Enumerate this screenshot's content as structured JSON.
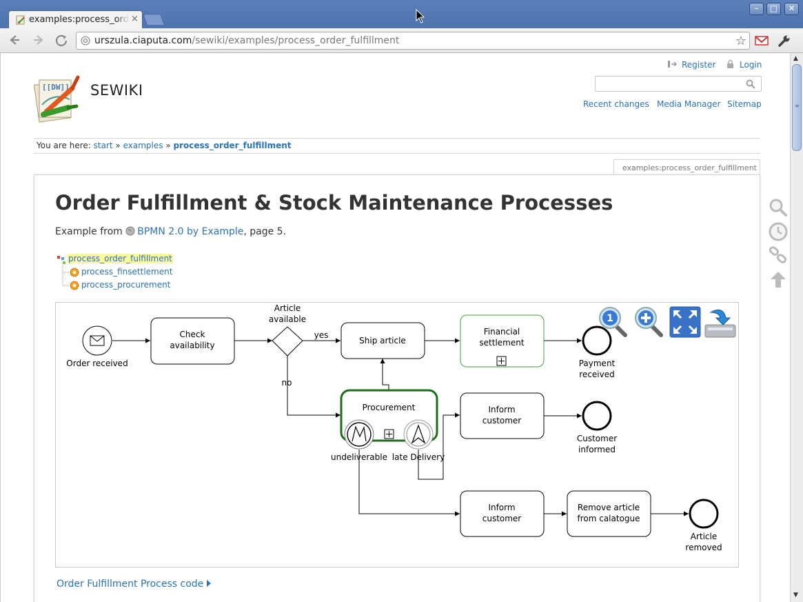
{
  "browser": {
    "tab_title": "examples:process_order_fulfillment",
    "tab_close": "×",
    "window_buttons": {
      "minimize": "–",
      "maximize": "□",
      "close": "✕"
    },
    "url_host": "urszula.ciaputa.com",
    "url_path": "/sewiki/examples/process_order_fulfillment"
  },
  "site": {
    "title": "SEWIKI",
    "user_links": {
      "register": "Register",
      "login": "Login"
    },
    "search_placeholder": "",
    "nav_links": {
      "recent": "Recent changes",
      "media": "Media Manager",
      "sitemap": "Sitemap"
    }
  },
  "breadcrumb": {
    "prefix": "You are here:",
    "separator": "»",
    "items": [
      "start",
      "examples",
      "process_order_fulfillment"
    ]
  },
  "page": {
    "id_label": "examples:process_order_fulfillment",
    "heading": "Order Fulfillment & Stock Maintenance Processes",
    "intro_prefix": "Example from",
    "intro_link": "BPMN 2.0 by Example",
    "intro_suffix": ", page 5.",
    "tree": {
      "root": "process_order_fulfillment",
      "children": [
        "process_finsettlement",
        "process_procurement"
      ]
    },
    "code_link": "Order Fulfillment Process code"
  },
  "diagram": {
    "labels": {
      "order_received": "Order received",
      "check_availability": [
        "Check",
        "availability"
      ],
      "article_available": [
        "Article",
        "available"
      ],
      "yes": "yes",
      "no": "no",
      "ship_article": "Ship article",
      "financial_settlement": [
        "Financial",
        "settlement"
      ],
      "payment_received": [
        "Payment",
        "received"
      ],
      "procurement": "Procurement",
      "undeliverable": "undeliverable",
      "late_delivery": "late Delivery",
      "inform_customer_1": [
        "Inform",
        "customer"
      ],
      "customer_informed": [
        "Customer",
        "informed"
      ],
      "inform_customer_2": [
        "Inform",
        "customer"
      ],
      "remove_article": [
        "Remove article",
        "from calatogue"
      ],
      "article_removed": [
        "Article",
        "removed"
      ]
    },
    "tools": [
      "zoom-reset",
      "zoom-in",
      "fullscreen",
      "download"
    ],
    "colors": {
      "highlight_green": "#1a6e1a",
      "subprocess_green": "#4a9a4a"
    }
  },
  "colors": {
    "link": "#2b73b7",
    "titlebar": "#5a7fb9",
    "tree_highlight": "#fafa9e"
  }
}
